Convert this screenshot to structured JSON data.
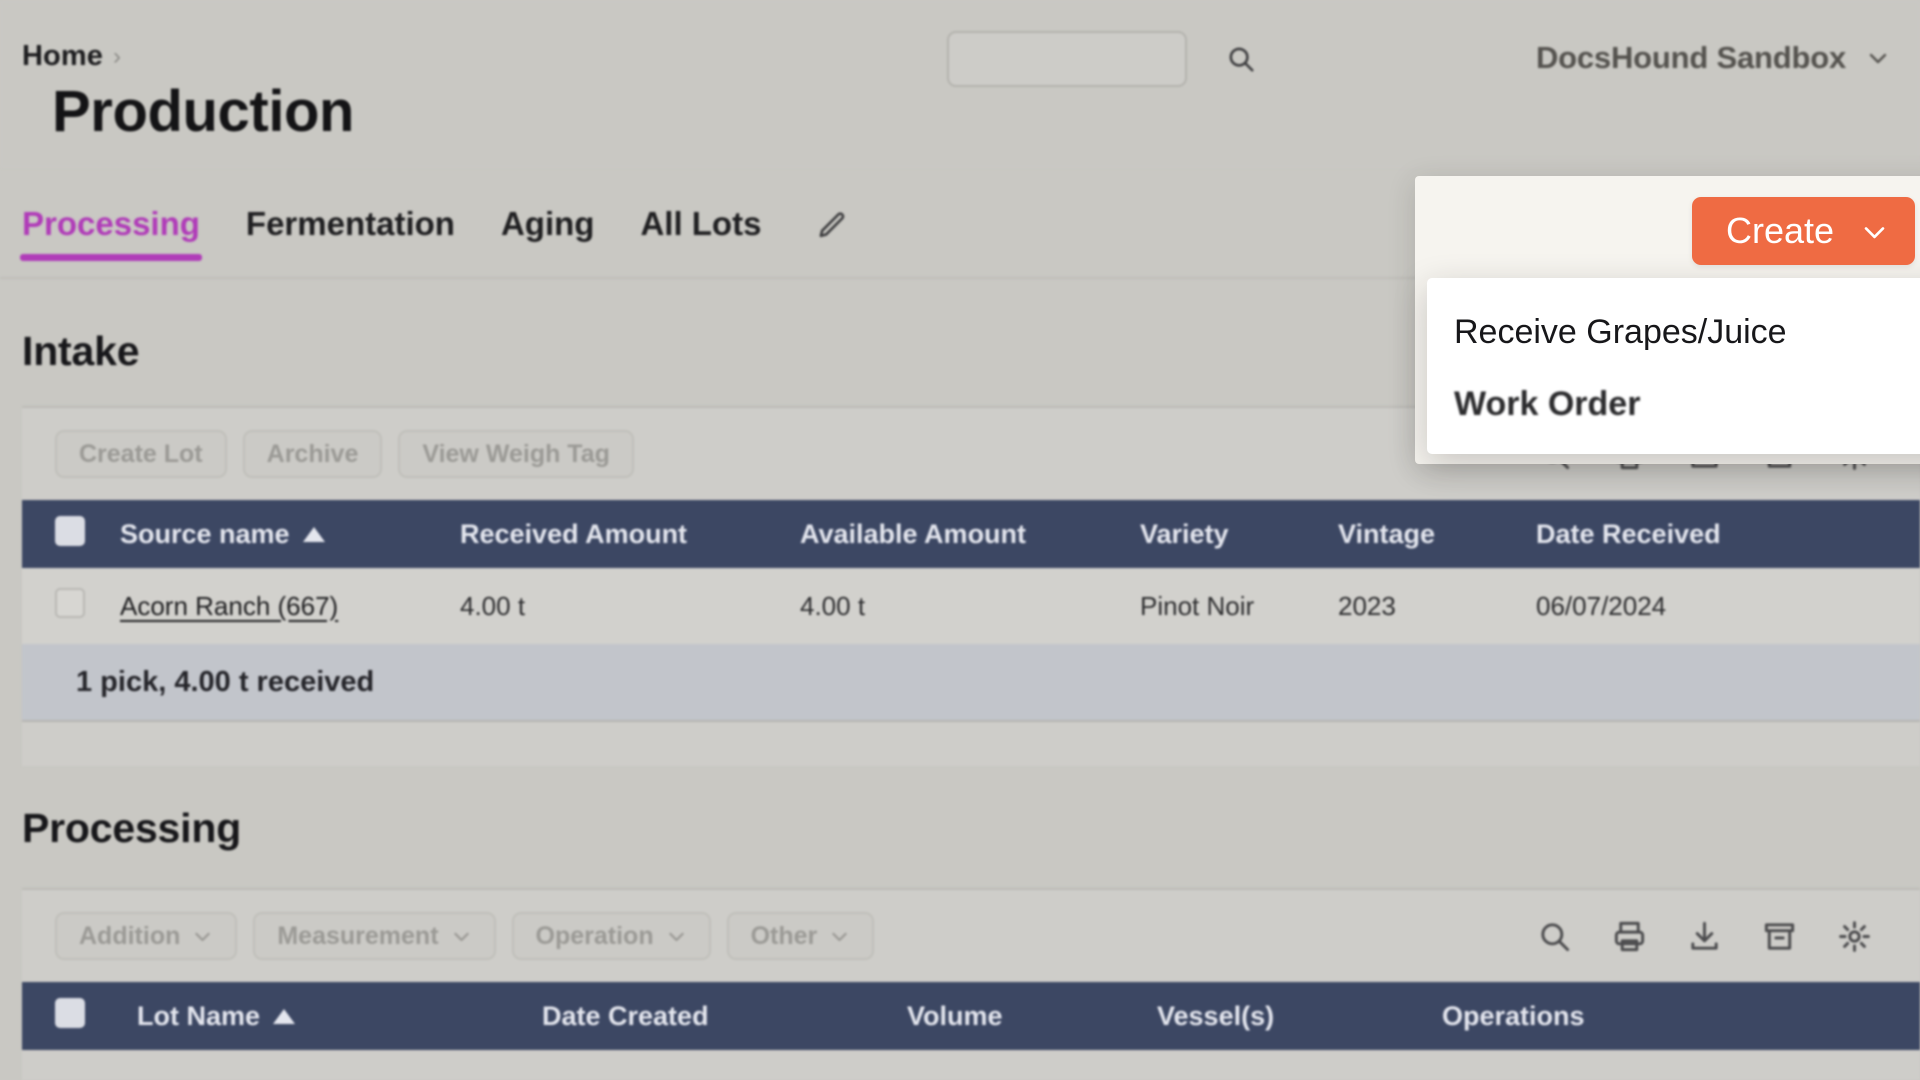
{
  "header": {
    "breadcrumb": {
      "home_label": "Home",
      "separator": "›"
    },
    "page_title": "Production",
    "search": {
      "value": "",
      "placeholder": "",
      "icon": "search-icon"
    },
    "account": {
      "name": "DocsHound Sandbox",
      "caret_icon": "chevron-down-icon"
    }
  },
  "tabs": {
    "items": [
      {
        "label": "Processing",
        "active": true
      },
      {
        "label": "Fermentation",
        "active": false
      },
      {
        "label": "Aging",
        "active": false
      },
      {
        "label": "All Lots",
        "active": false
      }
    ],
    "edit_icon": "pencil-icon",
    "active_color": "#b03cb8"
  },
  "create": {
    "button_label": "Create",
    "button_color": "#ef6b43",
    "caret_icon": "chevron-down-icon",
    "menu_items": [
      {
        "label": "Receive Grapes/Juice",
        "focused": true
      },
      {
        "label": "Work Order",
        "focused": false
      }
    ]
  },
  "intake": {
    "title": "Intake",
    "toolbar": {
      "buttons": [
        {
          "label": "Create Lot",
          "disabled": true
        },
        {
          "label": "Archive",
          "disabled": true
        },
        {
          "label": "View Weigh Tag",
          "disabled": true
        }
      ],
      "icons": [
        "search-icon",
        "print-icon",
        "download-icon",
        "archive-icon",
        "settings-gear-icon"
      ]
    },
    "table": {
      "columns": [
        {
          "label": "Source name",
          "sort": "asc"
        },
        {
          "label": "Received Amount",
          "sort": null
        },
        {
          "label": "Available Amount",
          "sort": null
        },
        {
          "label": "Variety",
          "sort": null
        },
        {
          "label": "Vintage",
          "sort": null
        },
        {
          "label": "Date Received",
          "sort": null
        }
      ],
      "rows": [
        {
          "source_name": "Acorn Ranch (667)",
          "received_amount": "4.00 t",
          "available_amount": "4.00 t",
          "variety": "Pinot Noir",
          "vintage": "2023",
          "date_received": "06/07/2024"
        }
      ],
      "summary": "1 pick, 4.00 t received"
    }
  },
  "processing": {
    "title": "Processing",
    "toolbar": {
      "buttons": [
        {
          "label": "Addition",
          "disabled": true,
          "caret": true
        },
        {
          "label": "Measurement",
          "disabled": true,
          "caret": true
        },
        {
          "label": "Operation",
          "disabled": true,
          "caret": true
        },
        {
          "label": "Other",
          "disabled": true,
          "caret": true
        }
      ],
      "icons": [
        "search-icon",
        "print-icon",
        "download-icon",
        "archive-icon",
        "settings-gear-icon"
      ]
    },
    "table": {
      "columns": [
        {
          "label": "Lot Name",
          "sort": "asc"
        },
        {
          "label": "Date Created",
          "sort": null
        },
        {
          "label": "Volume",
          "sort": null
        },
        {
          "label": "Vessel(s)",
          "sort": null
        },
        {
          "label": "Operations",
          "sort": null
        }
      ],
      "rows": []
    }
  },
  "theme": {
    "page_background": "#c9c8c3",
    "table_header_background": "#3c4763",
    "accent_orange": "#ef6b43",
    "accent_magenta": "#b03cb8"
  }
}
